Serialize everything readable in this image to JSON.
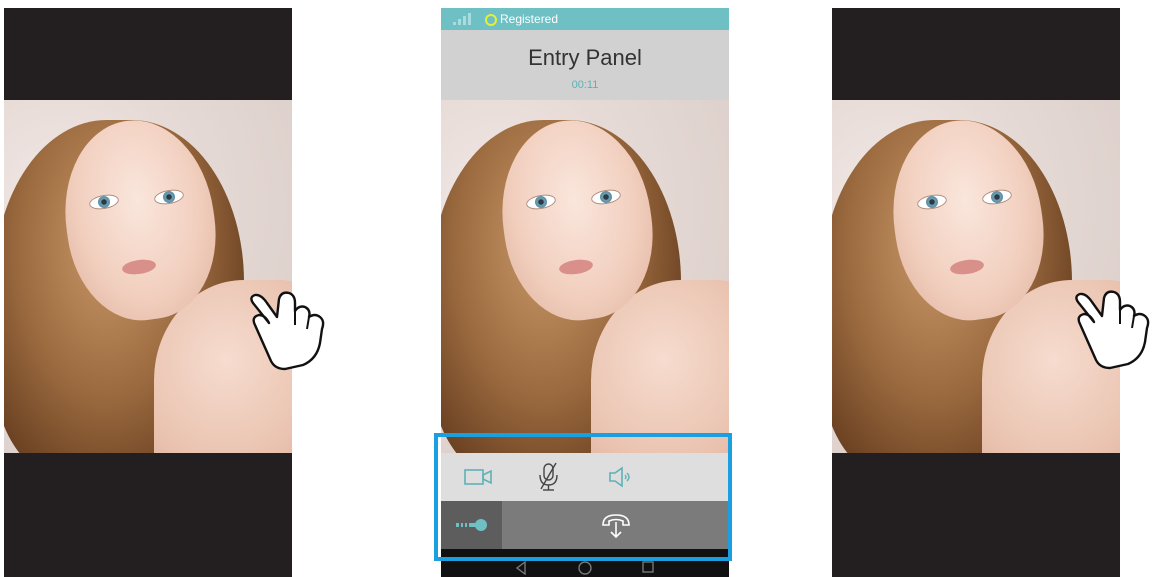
{
  "status_bar": {
    "registration_text": "Registered",
    "registration_color": "#e5ee3b",
    "bg_color": "#6fc0c4",
    "signal_icon": "signal-icon"
  },
  "call": {
    "title": "Entry Panel",
    "timer": "00:11"
  },
  "controls": {
    "video_icon": "video-camera-icon",
    "mic_icon": "microphone-muted-icon",
    "speaker_icon": "speaker-icon"
  },
  "actions": {
    "key_icon": "key-icon",
    "hangup_icon": "hangup-icon"
  },
  "navbar": {
    "icons": [
      "back-icon",
      "home-icon",
      "recents-icon"
    ]
  },
  "colors": {
    "accent": "#5eb1b6",
    "highlight": "#1aa0e0",
    "phone_bg": "#231f20"
  }
}
